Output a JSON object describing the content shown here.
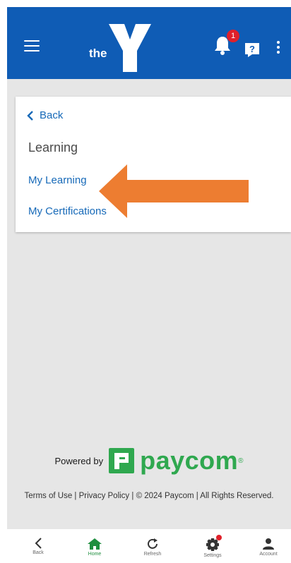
{
  "header": {
    "logo_text": "the",
    "notification_count": "1",
    "colors": {
      "bar": "#0f5cb5",
      "badge": "#e0202a"
    },
    "icons": [
      "menu-icon",
      "ymca-logo",
      "bell-icon",
      "help-icon",
      "more-vertical-icon"
    ]
  },
  "panel": {
    "back_label": "Back",
    "title": "Learning",
    "links": [
      "My Learning",
      "My Certifications"
    ]
  },
  "branding": {
    "powered_by": "Powered by",
    "paycom": "paycom",
    "color": "#2fa84f"
  },
  "footer": {
    "legal": "Terms of Use | Privacy Policy | © 2024 Paycom | All Rights Reserved."
  },
  "bottom_nav": {
    "items": [
      {
        "label": "Back",
        "icon": "chevron-left-icon"
      },
      {
        "label": "Home",
        "icon": "home-icon",
        "active": true
      },
      {
        "label": "Refresh",
        "icon": "refresh-icon"
      },
      {
        "label": "Settings",
        "icon": "gear-icon"
      },
      {
        "label": "Account",
        "icon": "user-icon"
      }
    ]
  },
  "annotation": {
    "arrow_color": "#ed7d31"
  }
}
